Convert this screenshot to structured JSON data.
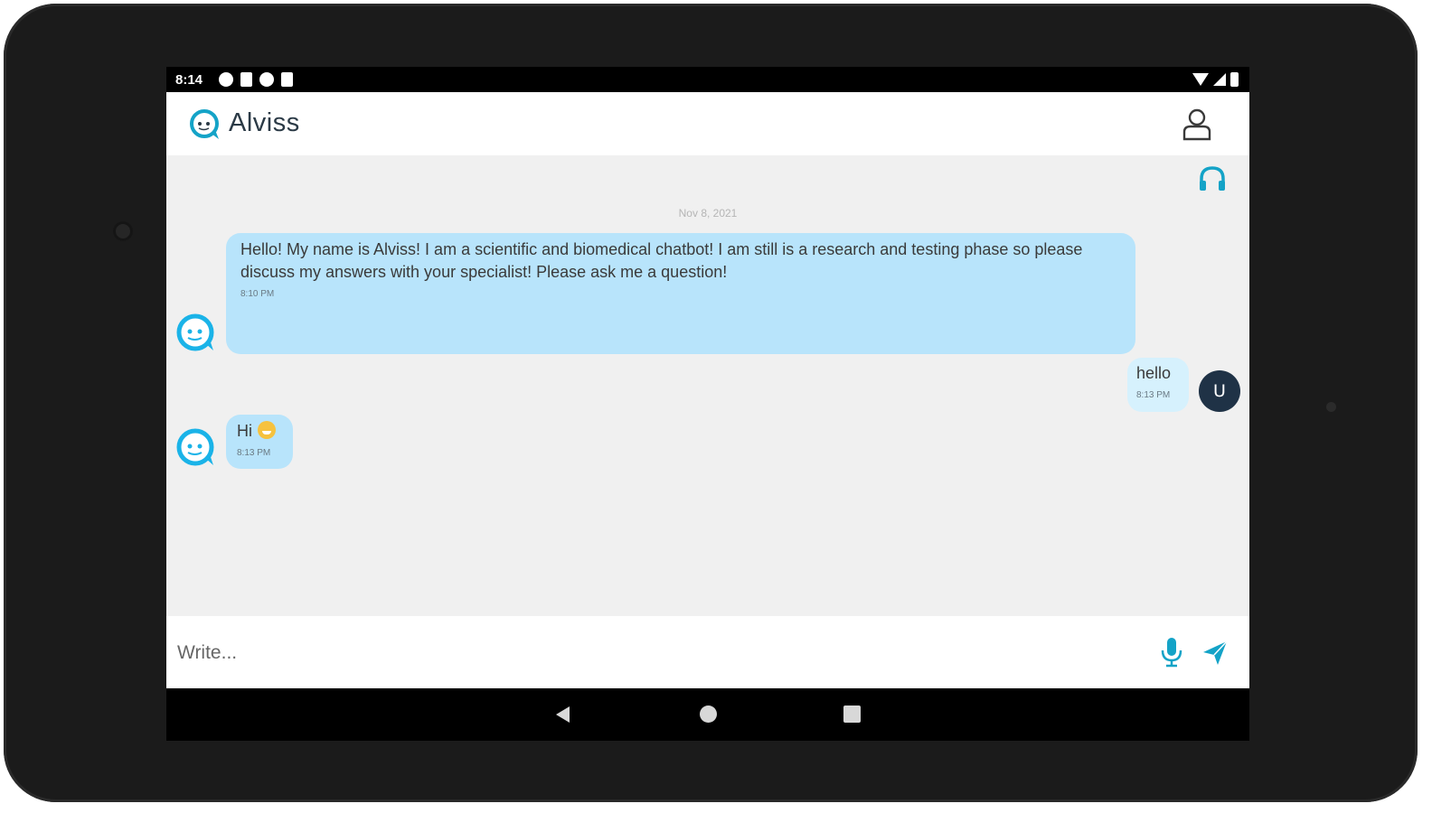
{
  "status_bar": {
    "time": "8:14"
  },
  "app": {
    "title": "Alviss"
  },
  "chat": {
    "date": "Nov 8, 2021",
    "messages": [
      {
        "sender": "bot",
        "text": "Hello! My name is Alviss! I am a scientific and biomedical chatbot! I am still is a research and testing phase so please discuss my answers with your specialist! Please ask me a question!",
        "time": "8:10 PM"
      },
      {
        "sender": "user",
        "text": "hello",
        "time": "8:13 PM"
      },
      {
        "sender": "bot",
        "text": "Hi",
        "time": "8:13 PM"
      }
    ],
    "user_initial": "U"
  },
  "composer": {
    "placeholder": "Write..."
  },
  "colors": {
    "accent": "#14a3c7",
    "bot_bubble": "#b8e4fb",
    "user_bubble": "#d6f1fd",
    "chat_bg": "#f0f0f0",
    "user_avatar": "#1f3246"
  },
  "icons": {
    "logo": "chat-bubble-face-icon",
    "profile": "user-outline-icon",
    "support": "headset-icon",
    "mic": "microphone-icon",
    "send": "paper-plane-icon",
    "nav": [
      "back-triangle-icon",
      "home-circle-icon",
      "recents-square-icon"
    ]
  }
}
